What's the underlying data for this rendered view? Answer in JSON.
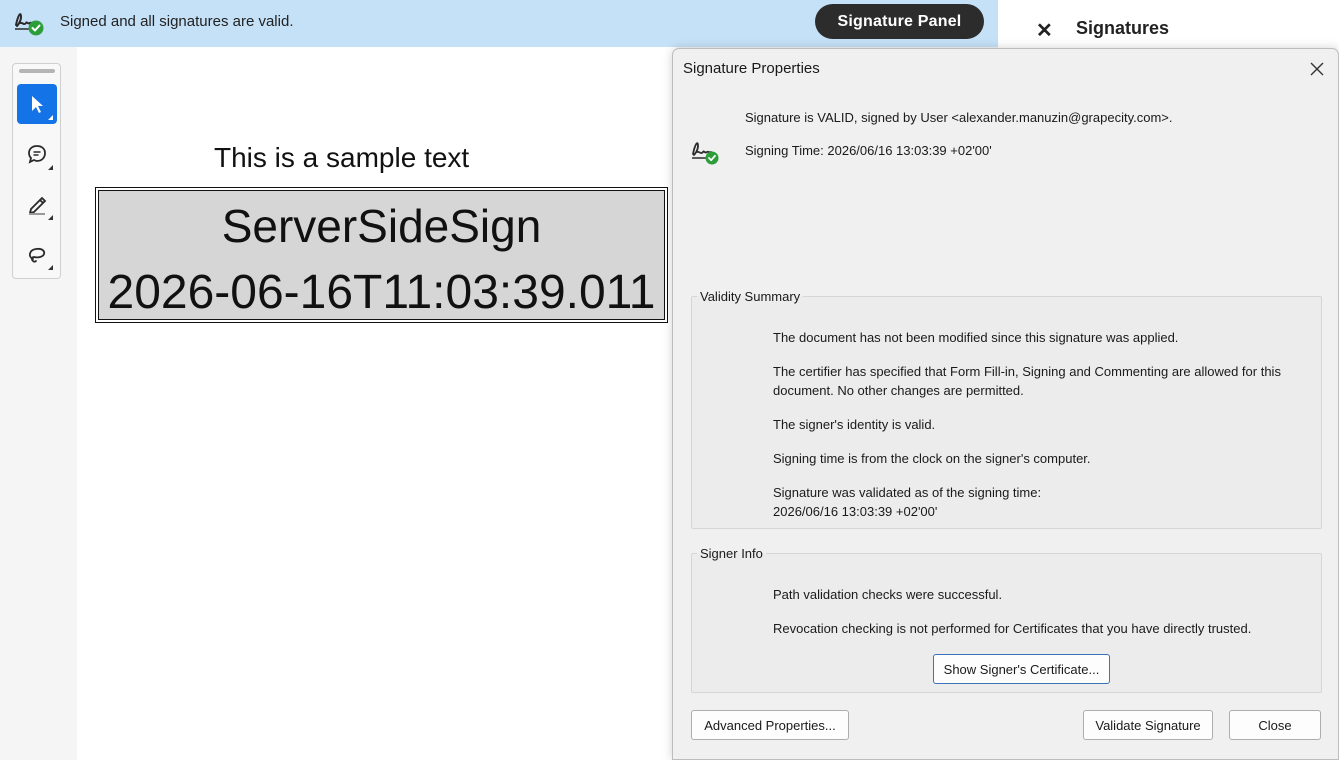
{
  "notification": {
    "message": "Signed and all signatures are valid.",
    "panel_button": "Signature Panel",
    "icon": "signature-valid-icon"
  },
  "side_panel": {
    "close_glyph": "✕",
    "title": "Signatures"
  },
  "toolbar": {
    "tools": [
      {
        "name": "select-tool",
        "icon": "arrow-cursor-icon",
        "active": true
      },
      {
        "name": "comment-tool",
        "icon": "speech-bubble-icon",
        "active": false
      },
      {
        "name": "highlight-tool",
        "icon": "pen-icon",
        "active": false
      },
      {
        "name": "draw-tool",
        "icon": "lasso-icon",
        "active": false
      }
    ],
    "active_color": "#1473e6"
  },
  "document": {
    "sample_text": "This is a sample text",
    "signature_line1": "ServerSideSign",
    "signature_line2": "2026-06-16T11:03:39.011"
  },
  "dialog": {
    "title": "Signature Properties",
    "status": "Signature is VALID, signed by User <alexander.manuzin@grapecity.com>.",
    "signing_time": "Signing Time:  2026/06/16 13:03:39 +02'00'",
    "validity_summary": {
      "legend": "Validity Summary",
      "lines": [
        "The document has not been modified since this signature was applied.",
        "The certifier has specified that Form Fill-in, Signing and Commenting are allowed for this document. No other changes are permitted.",
        "The signer's identity is valid.",
        "Signing time is from the clock on the signer's computer.",
        "Signature was validated as of the signing time:",
        "2026/06/16 13:03:39 +02'00'"
      ]
    },
    "signer_info": {
      "legend": "Signer Info",
      "lines": [
        "Path validation checks were successful.",
        "Revocation checking is not performed for Certificates that you have directly trusted."
      ],
      "certificate_button": "Show Signer's Certificate..."
    },
    "buttons": {
      "advanced": "Advanced Properties...",
      "validate": "Validate Signature",
      "close": "Close"
    }
  }
}
